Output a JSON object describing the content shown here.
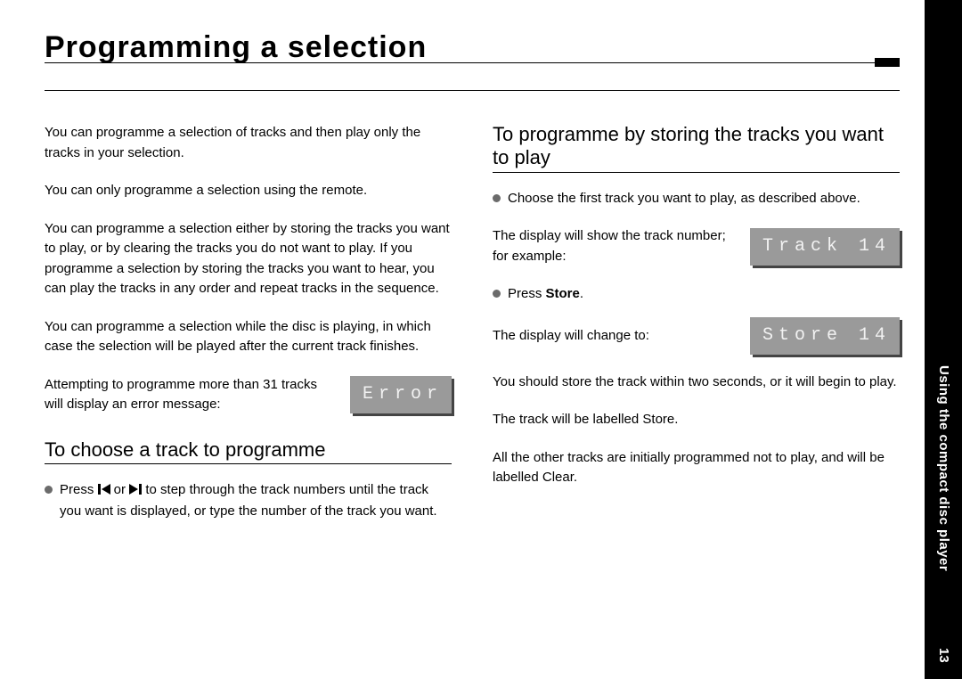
{
  "title": "Programming a selection",
  "sidebar": {
    "section": "Using the compact disc player",
    "page": "13"
  },
  "left": {
    "p1": "You can programme a selection of tracks and then play only the tracks in your selection.",
    "p2": "You can only programme a selection using the remote.",
    "p3": "You can programme a selection either by storing the tracks you want to play, or by clearing the tracks you do not want to play. If you programme a selection by storing the tracks you want to hear, you can play the tracks in any order and repeat tracks in the sequence.",
    "p4": "You can programme a selection while the disc is playing, in which case the selection will be played after the current track finishes.",
    "p5": "Attempting to programme more than 31 tracks will display an error message:",
    "lcd_error": "Error",
    "h1": "To choose a track to programme",
    "b1_pre": "Press ",
    "b1_mid": " or ",
    "b1_post": " to step through the track numbers until the track you want is displayed, or type the number of the track you want."
  },
  "right": {
    "h1": "To programme by storing the tracks you want to play",
    "b1": "Choose the first track you want to play, as described above.",
    "p1": "The display will show the track number; for example:",
    "lcd_track": "Track 14",
    "b2_pre": "Press ",
    "b2_bold": "Store",
    "b2_post": ".",
    "p2": "The display will change to:",
    "lcd_store": "Store 14",
    "p3": "You should store the track within two seconds, or it will begin to play.",
    "p4": "The track will be labelled Store.",
    "p5": "All the other tracks are initially programmed not to play, and will be labelled Clear."
  }
}
